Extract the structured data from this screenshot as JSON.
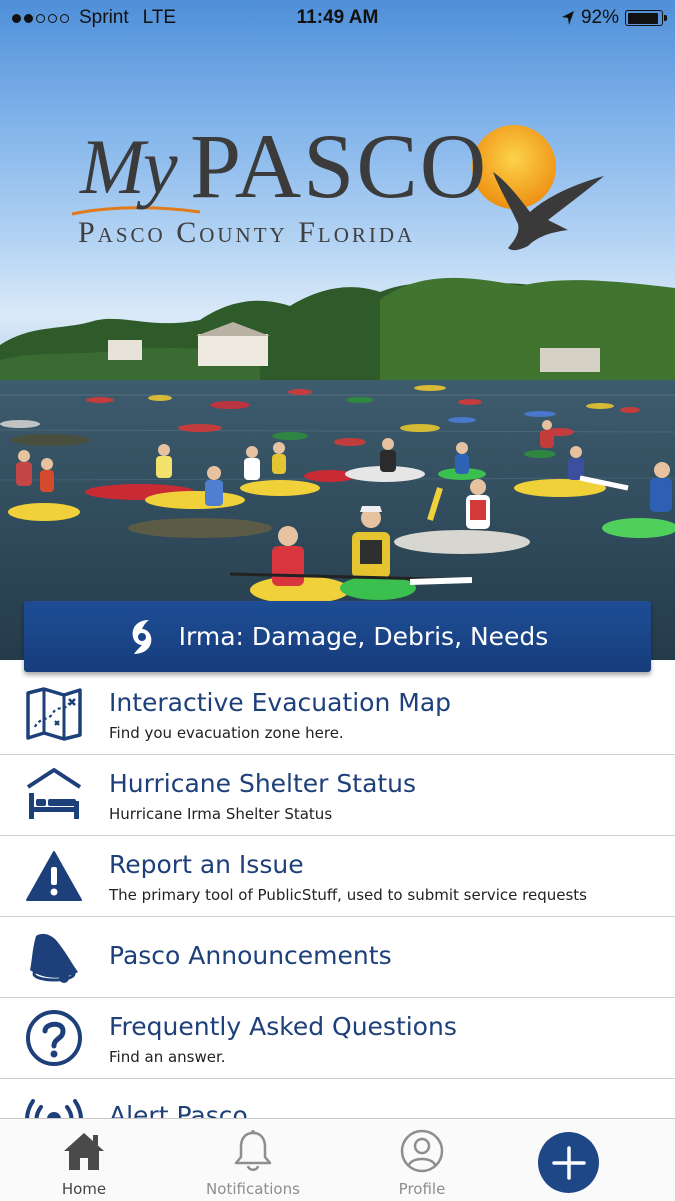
{
  "status_bar": {
    "carrier": "Sprint",
    "network": "LTE",
    "time": "11:49 AM",
    "battery": "92%",
    "battery_level": 0.92,
    "signal_bars_filled": 2,
    "signal_bars_total": 5
  },
  "hero": {
    "logo_my": "My",
    "logo_pasco": "PASCO",
    "logo_subtitle": "Pasco County Florida"
  },
  "banner": {
    "label": "Irma: Damage, Debris, Needs",
    "icon": "hurricane-icon"
  },
  "menu": [
    {
      "title": "Interactive Evacuation Map",
      "subtitle": "Find you evacuation zone here.",
      "icon": "map-icon"
    },
    {
      "title": "Hurricane Shelter Status",
      "subtitle": "Hurricane Irma Shelter Status",
      "icon": "shelter-bed-icon"
    },
    {
      "title": "Report an Issue",
      "subtitle": "The primary tool of PublicStuff, used to submit service requests",
      "icon": "warning-icon"
    },
    {
      "title": "Pasco Announcements",
      "subtitle": "",
      "icon": "bell-icon"
    },
    {
      "title": "Frequently Asked Questions",
      "subtitle": "Find an answer.",
      "icon": "question-icon"
    },
    {
      "title": "Alert Pasco",
      "subtitle": "",
      "icon": "broadcast-icon"
    }
  ],
  "tabs": [
    {
      "label": "Home",
      "icon": "home-icon",
      "active": true
    },
    {
      "label": "Notifications",
      "icon": "bell-icon",
      "active": false
    },
    {
      "label": "Profile",
      "icon": "profile-icon",
      "active": false
    }
  ],
  "fab": {
    "icon": "plus-icon"
  },
  "colors": {
    "brand_blue": "#1d3f7a",
    "banner_blue": "#1e4d95",
    "logo_gray": "#3b3b3b",
    "sun_orange": "#f2a51c"
  }
}
